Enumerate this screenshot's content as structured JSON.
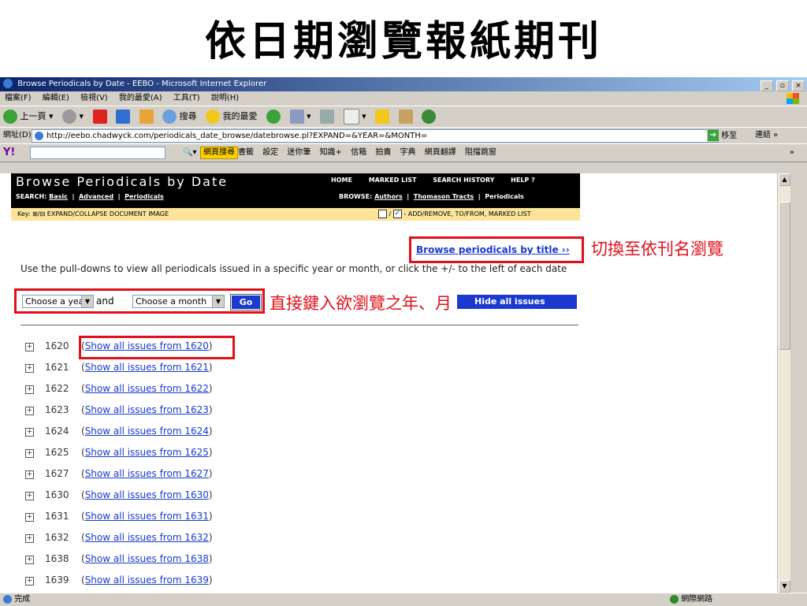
{
  "slide": {
    "title": "依日期瀏覽報紙期刊"
  },
  "window": {
    "title": "Browse Periodicals by Date - EEBO - Microsoft Internet Explorer",
    "controls": [
      "_",
      "▫",
      "×"
    ]
  },
  "menu": [
    "檔案(F)",
    "編輯(E)",
    "檢視(V)",
    "我的最愛(A)",
    "工具(T)",
    "說明(H)"
  ],
  "toolbar": {
    "back": "上一頁",
    "search": "搜尋",
    "favorites": "我的最愛"
  },
  "address": {
    "label": "網址(D)",
    "url": "http://eebo.chadwyck.com/periodicals_date_browse/datebrowse.pl?EXPAND=&YEAR=&MONTH=",
    "go": "移至",
    "links": "連結"
  },
  "yahoo": {
    "logo": "Y!",
    "search_button": "網頁搜尋",
    "items": [
      "書籤",
      "設定",
      "迷你筆",
      "知識+",
      "信箱",
      "拍賣",
      "字典",
      "網頁翻譯",
      "阻擋跳窗"
    ]
  },
  "eebo": {
    "header_title": "Browse Periodicals by Date",
    "nav": [
      "HOME",
      "MARKED LIST",
      "SEARCH HISTORY",
      "HELP ?"
    ],
    "search_label": "SEARCH:",
    "search_links": [
      "Basic",
      "Advanced",
      "Periodicals"
    ],
    "browse_label": "BROWSE:",
    "browse_links": [
      "Authors",
      "Thomason Tracts",
      "Periodicals"
    ],
    "key_left": "Key: ⊞/⊟ EXPAND/COLLAPSE  DOCUMENT IMAGE",
    "key_right": "- ADD/REMOVE, TO/FROM, MARKED LIST"
  },
  "content": {
    "by_title_link": "Browse periodicals by title ››",
    "instructions": "Use the pull-downs to view all periodicals issued in a specific year or month, or click the +/- to the left of each date",
    "year_select": "Choose a year",
    "and": "and",
    "month_select": "Choose a month",
    "go": "Go",
    "hide_all": "Hide all issues",
    "years": [
      {
        "year": "1620",
        "link": "Show all issues from 1620"
      },
      {
        "year": "1621",
        "link": "Show all issues from 1621"
      },
      {
        "year": "1622",
        "link": "Show all issues from 1622"
      },
      {
        "year": "1623",
        "link": "Show all issues from 1623"
      },
      {
        "year": "1624",
        "link": "Show all issues from 1624"
      },
      {
        "year": "1625",
        "link": "Show all issues from 1625"
      },
      {
        "year": "1627",
        "link": "Show all issues from 1627"
      },
      {
        "year": "1630",
        "link": "Show all issues from 1630"
      },
      {
        "year": "1631",
        "link": "Show all issues from 1631"
      },
      {
        "year": "1632",
        "link": "Show all issues from 1632"
      },
      {
        "year": "1638",
        "link": "Show all issues from 1638"
      },
      {
        "year": "1639",
        "link": "Show all issues from 1639"
      }
    ]
  },
  "annotations": {
    "by_title": "切換至依刊名瀏覽",
    "select": "直接鍵入欲瀏覽之年、月"
  },
  "status": {
    "left": "完成",
    "zone": "網際網路"
  },
  "colors": {
    "accent_red": "#e0101a",
    "link_blue": "#1a3acf",
    "header_black": "#000000",
    "key_yellow": "#fce49a"
  }
}
